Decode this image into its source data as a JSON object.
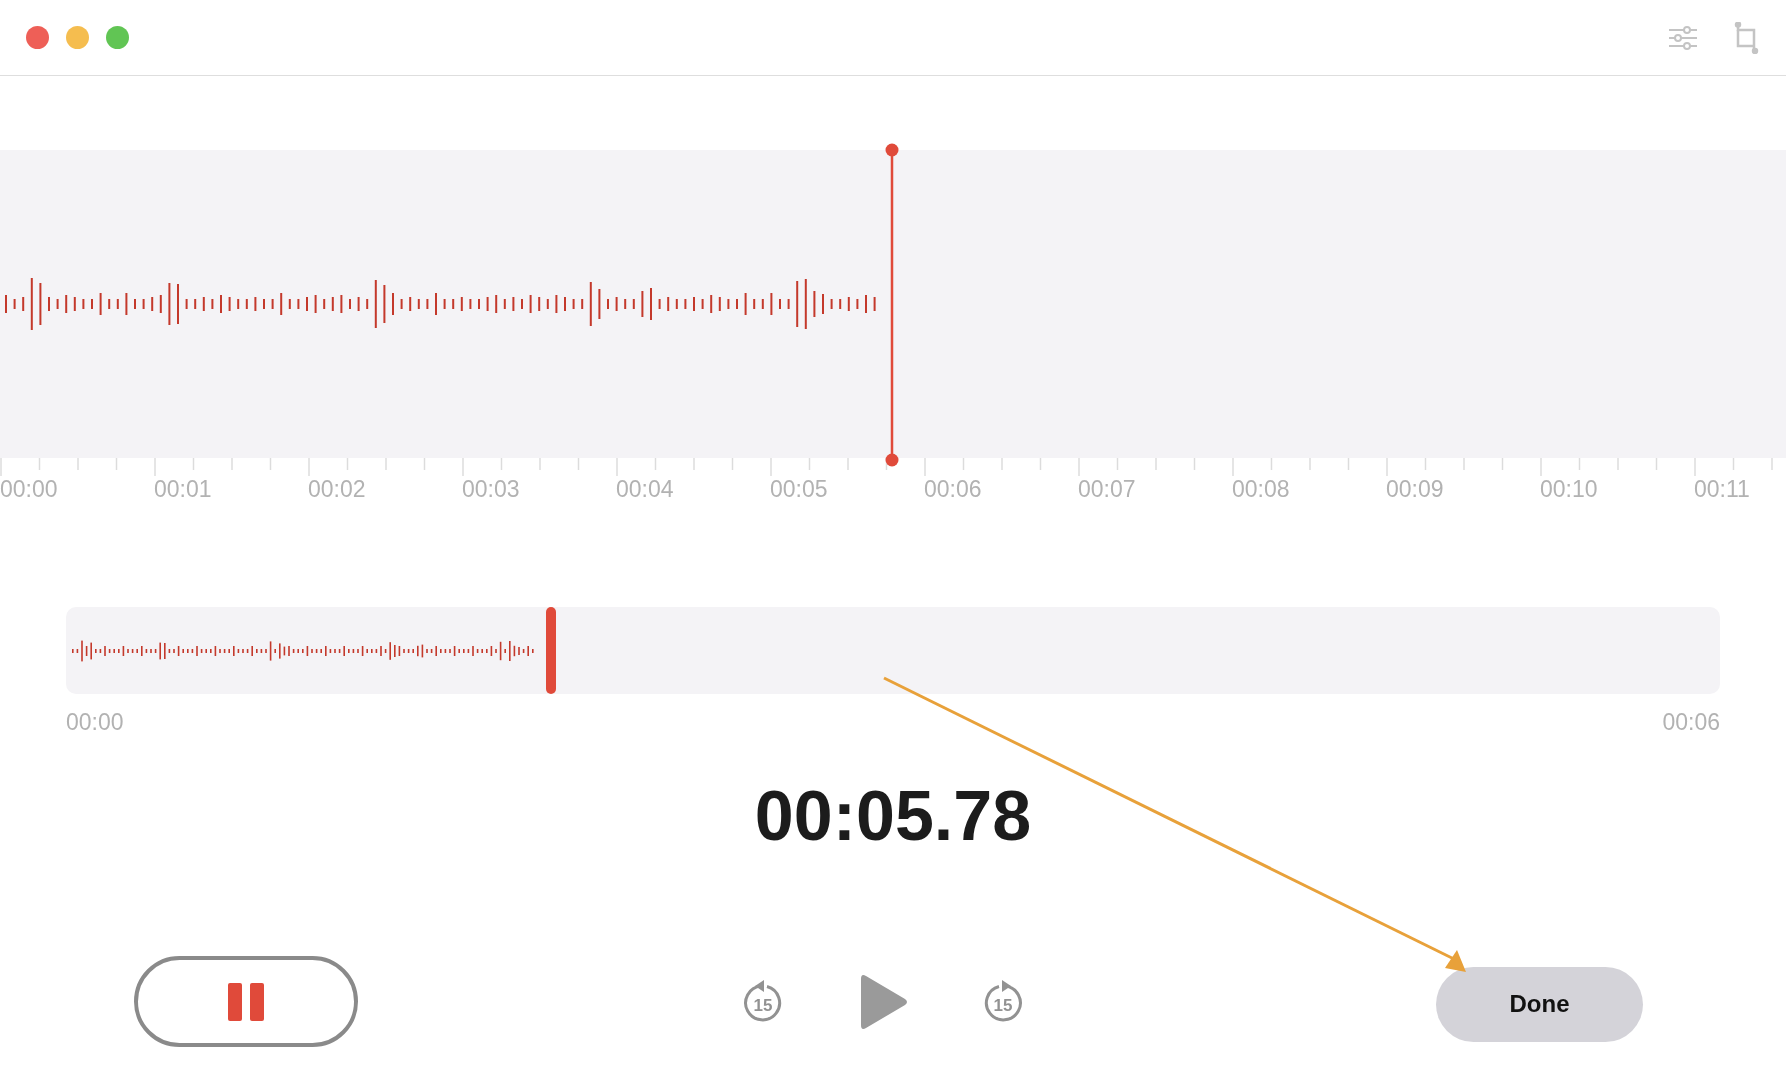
{
  "window": {
    "controls": [
      {
        "color": "#ee5f57"
      },
      {
        "color": "#f5bd4f"
      },
      {
        "color": "#61c554"
      }
    ]
  },
  "timeline": {
    "labels": [
      "00:00",
      "00:01",
      "00:02",
      "00:03",
      "00:04",
      "00:05",
      "00:06",
      "00:07",
      "00:08",
      "00:09",
      "00:10",
      "00:11"
    ]
  },
  "overview": {
    "level": 0.29,
    "start_label": "00:00",
    "end_label": "00:06"
  },
  "elapsed": "00:05.78",
  "transport": {
    "recording": true,
    "skip_back": "15",
    "skip_forward": "15",
    "done": "Done"
  }
}
